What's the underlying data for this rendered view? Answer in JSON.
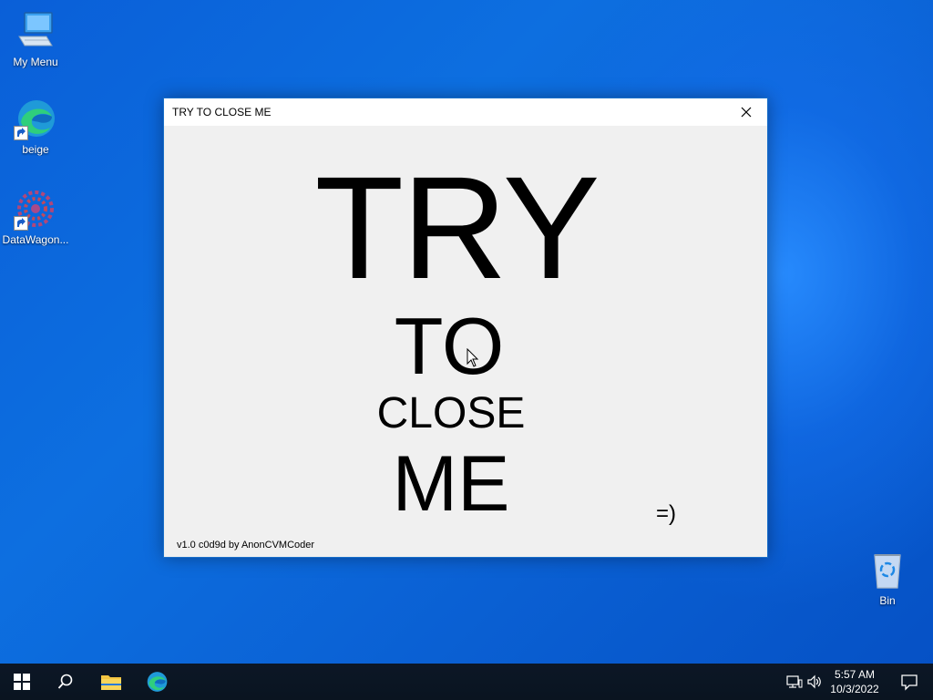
{
  "desktop": {
    "icons": [
      {
        "label": "My Menu"
      },
      {
        "label": "beige"
      },
      {
        "label": "DataWagon..."
      },
      {
        "label": "Bin"
      }
    ]
  },
  "window": {
    "title": "TRY TO CLOSE ME",
    "words": [
      "TRY",
      "TO",
      "CLOSE",
      "ME"
    ],
    "smiley": "=)",
    "version": "v1.0 c0d9d by AnonCVMCoder"
  },
  "taskbar": {
    "time": "5:57 AM",
    "date": "10/3/2022"
  },
  "colors": {
    "desktop_blue": "#0b63d6",
    "taskbar": "#0a1420",
    "window_bg": "#f0f0f0"
  }
}
